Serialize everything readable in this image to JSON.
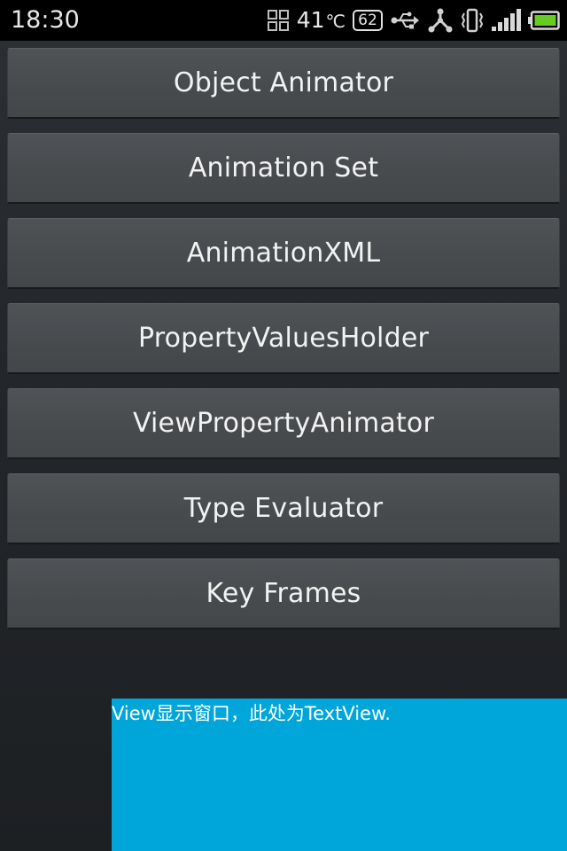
{
  "status_bar": {
    "time": "18:30",
    "temperature_value": "41",
    "temperature_unit": "℃",
    "memory_badge": "62",
    "icons": [
      "apps-grid-icon",
      "usb-icon",
      "share-hub-icon",
      "vibrate-icon",
      "signal-icon",
      "battery-icon"
    ],
    "battery_color": "#66cc22"
  },
  "buttons": [
    {
      "label": "Object Animator"
    },
    {
      "label": "Animation Set"
    },
    {
      "label": "AnimationXML"
    },
    {
      "label": "PropertyValuesHolder"
    },
    {
      "label": "ViewPropertyAnimator"
    },
    {
      "label": "Type Evaluator"
    },
    {
      "label": "Key Frames"
    }
  ],
  "text_view": {
    "text": "View显示窗口，此处为TextView.",
    "background_color": "#00a6d9"
  }
}
